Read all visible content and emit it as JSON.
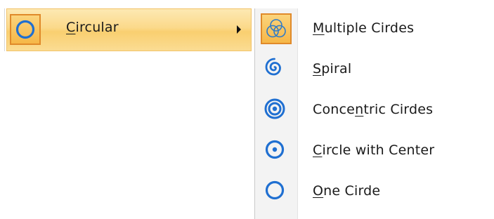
{
  "parent_item": {
    "label_underlined": "C",
    "label_rest": "ircular",
    "icon": "circle-outline-icon",
    "has_submenu_arrow": true
  },
  "submenu": {
    "items": [
      {
        "pre": "",
        "u": "M",
        "post": "ultiple Cirdes",
        "icon": "multiple-circles-icon",
        "selected": true
      },
      {
        "pre": "",
        "u": "S",
        "post": "piral",
        "icon": "spiral-icon",
        "selected": false
      },
      {
        "pre": "Conce",
        "u": "n",
        "post": "tric Cirdes",
        "icon": "concentric-circles-icon",
        "selected": false
      },
      {
        "pre": "",
        "u": "C",
        "post": "ircle with Center",
        "icon": "circle-with-center-icon",
        "selected": false
      },
      {
        "pre": "",
        "u": "O",
        "post": "ne Cirde",
        "icon": "one-circle-icon",
        "selected": false
      }
    ]
  },
  "colors": {
    "accent_blue": "#1f6fd1",
    "highlight_border": "#e08a2a",
    "highlight_fill": "#f9cf70"
  }
}
